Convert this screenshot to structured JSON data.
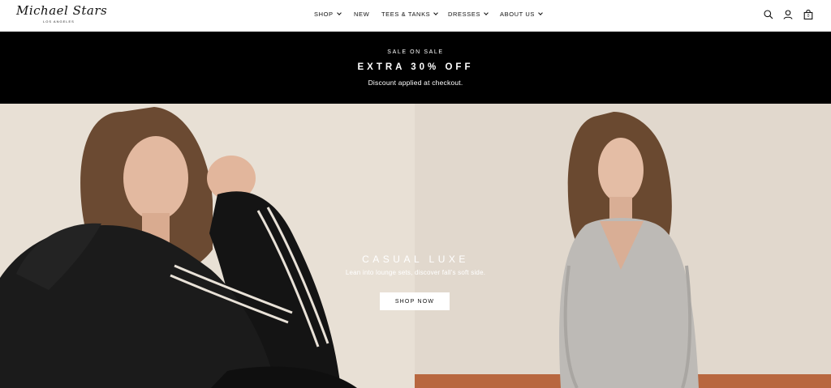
{
  "brand": {
    "logo_text": "Michael Stars",
    "logo_subtext": "LOS ANGELES"
  },
  "nav": {
    "items": [
      {
        "label": "SHOP",
        "has_dropdown": true
      },
      {
        "label": "NEW",
        "has_dropdown": false
      },
      {
        "label": "TEES & TANKS",
        "has_dropdown": true
      },
      {
        "label": "DRESSES",
        "has_dropdown": true
      },
      {
        "label": "ABOUT US",
        "has_dropdown": true
      }
    ]
  },
  "utilities": {
    "search_icon": "search-icon",
    "account_icon": "account-icon",
    "cart_icon": "shopping-bag-icon",
    "cart_count": "0"
  },
  "promo": {
    "eyebrow": "SALE ON SALE",
    "title": "EXTRA 30% OFF",
    "note": "Discount applied at checkout."
  },
  "hero": {
    "title": "CASUAL LUXE",
    "subtitle": "Lean into lounge sets, discover fall's soft side.",
    "cta_label": "SHOP NOW"
  },
  "colors": {
    "promo_bg": "#000000",
    "hero_left_bg": "#e9e2d8",
    "hero_right_bg": "#e2d9ce"
  }
}
